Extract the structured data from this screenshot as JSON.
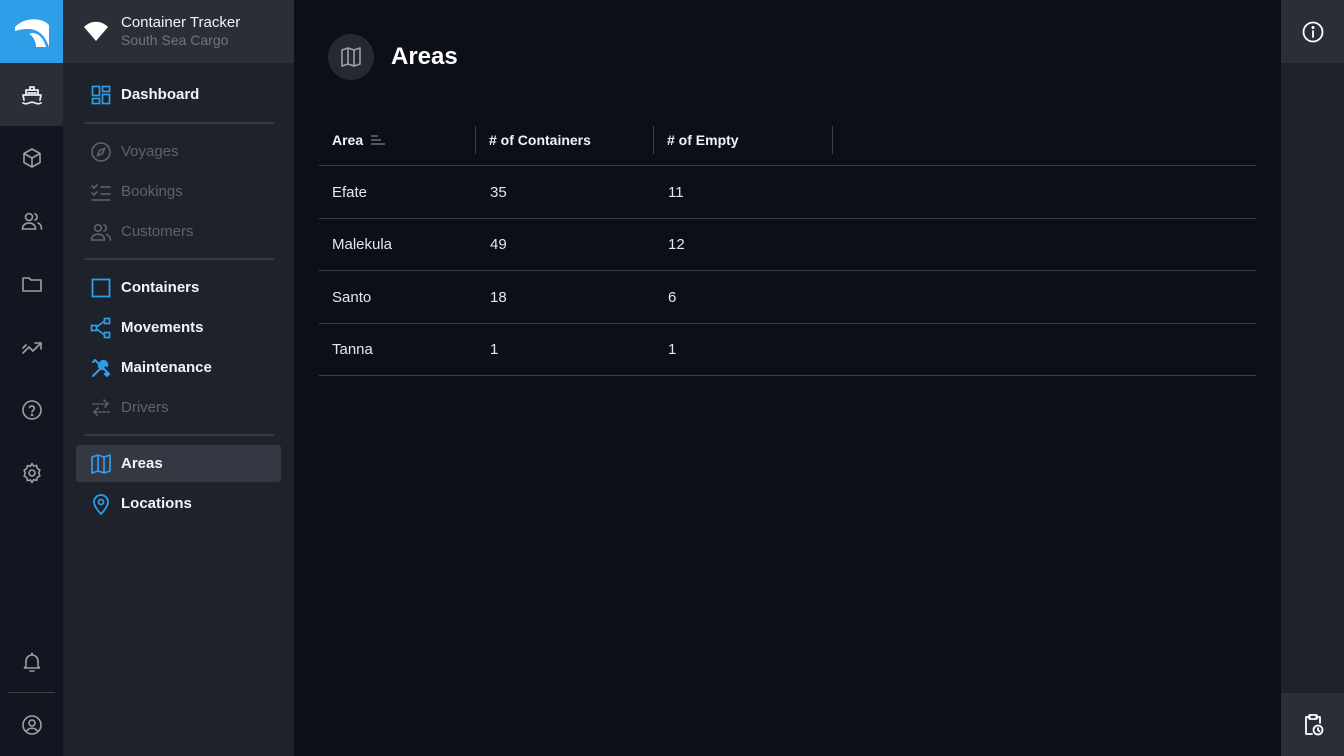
{
  "app": {
    "title": "Container Tracker",
    "subtitle": "South Sea Cargo",
    "accent_color": "#2f9ee8"
  },
  "rail": {
    "icons": [
      "logo-icon",
      "ship-icon",
      "box-icon",
      "users-icon",
      "folder-icon",
      "trend-icon",
      "help-icon",
      "settings-icon",
      "bell-icon",
      "account-icon"
    ],
    "active": "ship-icon"
  },
  "nav": {
    "dashboard": "Dashboard",
    "voyages": "Voyages",
    "bookings": "Bookings",
    "customers": "Customers",
    "containers": "Containers",
    "movements": "Movements",
    "maintenance": "Maintenance",
    "drivers": "Drivers",
    "areas": "Areas",
    "locations": "Locations",
    "selected": "Areas"
  },
  "page": {
    "title": "Areas",
    "icon": "map-icon"
  },
  "table": {
    "columns": [
      "Area",
      "# of Containers",
      "# of Empty"
    ],
    "sort_column": "Area",
    "rows": [
      {
        "area": "Efate",
        "containers": "35",
        "empty": "11"
      },
      {
        "area": "Malekula",
        "containers": "49",
        "empty": "12"
      },
      {
        "area": "Santo",
        "containers": "18",
        "empty": "6"
      },
      {
        "area": "Tanna",
        "containers": "1",
        "empty": "1"
      }
    ]
  },
  "right_rail": {
    "icons": [
      "info-icon",
      "clipboard-clock-icon"
    ]
  }
}
